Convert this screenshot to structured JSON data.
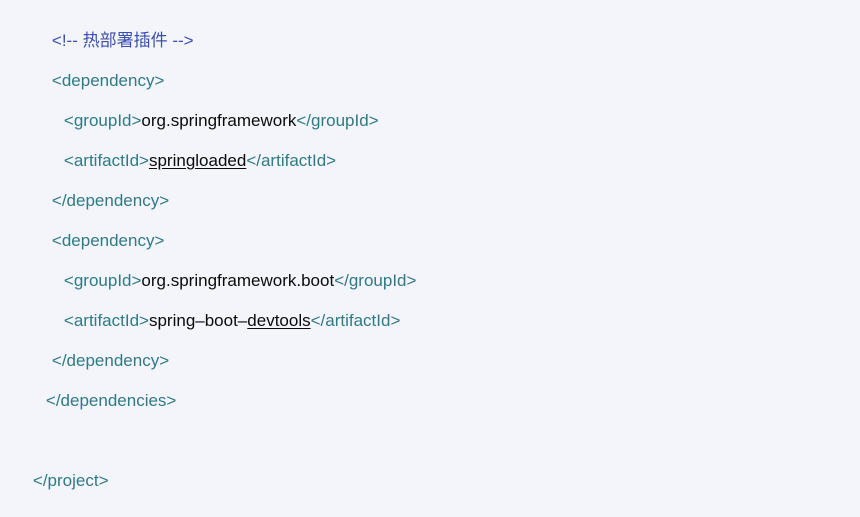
{
  "code": {
    "comment": "<!-- 热部署插件 -->",
    "dep1_open": "<dependency>",
    "dep1_group_open": "<groupId>",
    "dep1_group_value": "org.springframework",
    "dep1_group_close": "</groupId>",
    "dep1_artifact_open": "<artifactId>",
    "dep1_artifact_value": "springloaded",
    "dep1_artifact_close": "</artifactId>",
    "dep1_close": "</dependency>",
    "dep2_open": "<dependency>",
    "dep2_group_open": "<groupId>",
    "dep2_group_value": "org.springframework.boot",
    "dep2_group_close": "</groupId>",
    "dep2_artifact_open": "<artifactId>",
    "dep2_artifact_value_prefix": "spring–boot–",
    "dep2_artifact_value_underlined": "devtools",
    "dep2_artifact_close": "</artifactId>",
    "dep2_close": "</dependency>",
    "dependencies_close": "</dependencies>",
    "project_close": "</project>"
  },
  "colors": {
    "background": "#f4f5fa",
    "tag": "#2f7a86",
    "comment": "#3b4fae",
    "text": "#0b0b0b"
  }
}
